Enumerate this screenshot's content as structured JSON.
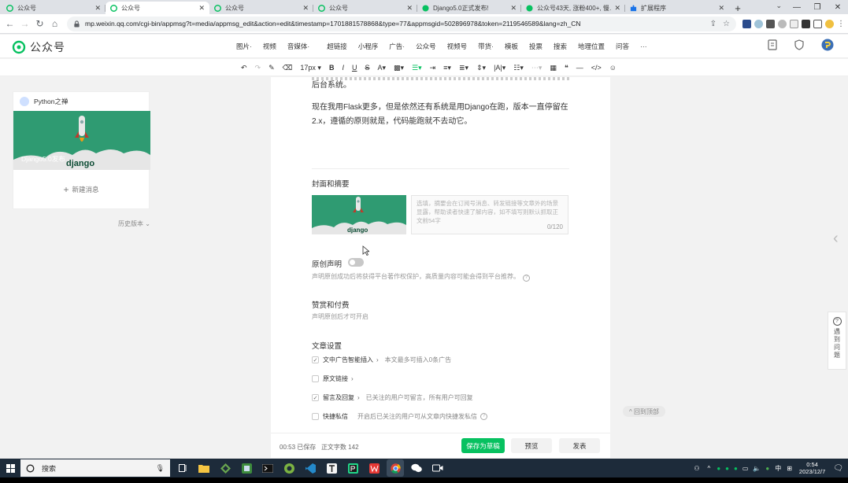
{
  "browser": {
    "tabs": [
      {
        "title": "公众号",
        "icon": "wechat-mp-icon",
        "active": false
      },
      {
        "title": "公众号",
        "icon": "wechat-mp-icon",
        "active": true
      },
      {
        "title": "公众号",
        "icon": "wechat-mp-icon",
        "active": false
      },
      {
        "title": "公众号",
        "icon": "wechat-mp-icon",
        "active": false
      },
      {
        "title": "Django5.0正式发布!",
        "icon": "wechat-icon",
        "active": false
      },
      {
        "title": "公众号43天, 涨粉400+, 慢…",
        "icon": "wechat-icon",
        "active": false
      },
      {
        "title": "扩展程序",
        "icon": "puzzle-icon",
        "active": false
      }
    ],
    "url": "mp.weixin.qq.com/cgi-bin/appmsg?t=media/appmsg_edit&action=edit&timestamp=1701881578868&type=77&appmsgid=502896978&token=2119546589&lang=zh_CN"
  },
  "header": {
    "logo_text": "公众号",
    "insert_menu": [
      "图片·",
      "视频",
      "音频·",
      "超链接",
      "小程序",
      "广告·",
      "公众号",
      "视频号",
      "带货·",
      "模板",
      "投票",
      "搜索",
      "地理位置",
      "问答",
      "···"
    ],
    "insert_menu_audio": "音频",
    "insert_menu_audio_full": "音媒体·"
  },
  "toolbar": {
    "font_size": "17px"
  },
  "left_panel": {
    "account_name": "Python之禅",
    "cover_title": "Django5.0发布",
    "cover_word": "django",
    "new_message": "新建消息",
    "history": "历史版本"
  },
  "article": {
    "line_partial": "后台系统。",
    "paragraph": "现在我用Flask更多，但是依然还有系统是用Django在跑，版本一直停留在2.x，遵循的原则就是，代码能跑就不去动它。",
    "cover_section": "封面和摘要",
    "summary_placeholder": "选填，摘要会在订阅号消息、转发链接等文章外的场景显露，帮助读者快速了解内容，如不填写则默认抓取正文前54字",
    "summary_count": "0/120",
    "thumb_word": "django",
    "original_label": "原创声明",
    "original_hint": "声明原创成功后将获得平台著作权保护，高质量内容可能会得到平台推荐。",
    "reward_section": "赞赏和付费",
    "reward_hint": "声明原创后才可开启",
    "settings_section": "文章设置",
    "settings": [
      {
        "label": "文中广告智能插入",
        "desc": "本文最多可插入0条广告",
        "checked": true,
        "arrow": true
      },
      {
        "label": "原文链接",
        "desc": "",
        "checked": false,
        "arrow": true
      },
      {
        "label": "留言及回复",
        "desc": "已关注的用户可留言，所有用户可回复",
        "checked": true,
        "arrow": true
      },
      {
        "label": "快捷私信",
        "desc": "开启后已关注的用户可从文章内快捷发私信",
        "checked": false,
        "arrow": false
      }
    ]
  },
  "bottom_bar": {
    "save_time": "00:53",
    "saved_label": "已保存",
    "word_count_label": "正文字数",
    "word_count": "142",
    "save_draft": "保存为草稿",
    "preview": "预览",
    "publish": "发表"
  },
  "side": {
    "back_to_top": "回到顶部",
    "help": [
      "遇",
      "到",
      "问",
      "题"
    ]
  },
  "taskbar": {
    "search_label": "搜索",
    "ime": "中",
    "time": "0:54",
    "date": "2023/12/7"
  },
  "colors": {
    "brand_green": "#07c160",
    "cover_green": "#2f9b72"
  }
}
